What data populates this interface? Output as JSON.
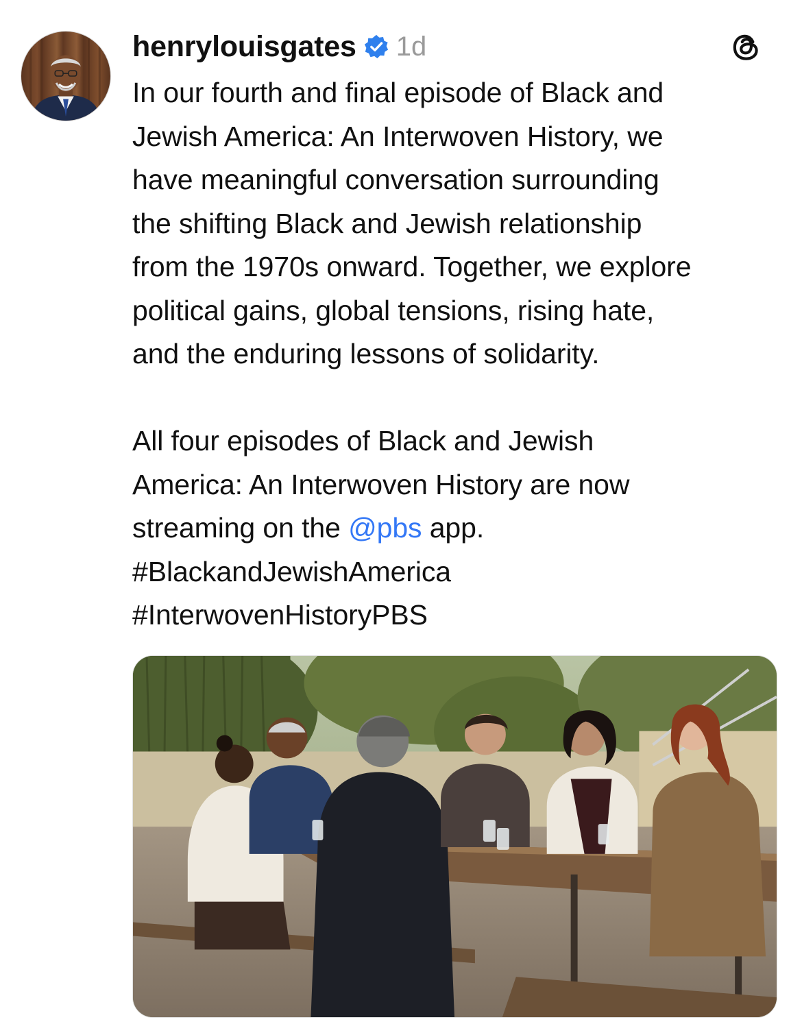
{
  "post": {
    "username": "henrylouisgates",
    "verified": true,
    "timestamp": "1d",
    "app_icon": "threads-icon",
    "paragraph1_lines": [
      "In our fourth and final episode of Black and",
      "Jewish America: An Interwoven History, we",
      "have meaningful conversation surrounding",
      "the shifting Black and Jewish relationship",
      "from the 1970s onward. Together, we explore",
      "political gains, global tensions, rising hate,",
      "and the enduring lessons of solidarity."
    ],
    "paragraph2": {
      "line1": "All four episodes of Black and Jewish",
      "line2": "America: An Interwoven History are now",
      "line3_before": "streaming on the ",
      "mention": "@pbs",
      "line3_after": " app.",
      "hashtag1": "#BlackandJewishAmerica",
      "hashtag2": "#InterwovenHistoryPBS"
    },
    "media": {
      "kind": "photo",
      "subject": "six people seated at an outdoor wooden table"
    }
  },
  "colors": {
    "text": "#111111",
    "timestamp": "#9a9a9a",
    "mention": "#3478f6",
    "verified_badge": "#2f80ed"
  }
}
